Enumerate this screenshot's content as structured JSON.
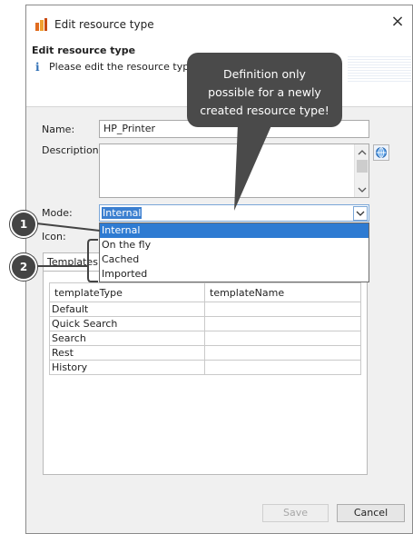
{
  "window": {
    "title": "Edit resource type",
    "close_symbol": "×",
    "icon": "app-icon"
  },
  "header": {
    "title": "Edit resource type",
    "info_symbol": "i",
    "message": "Please edit the resource type da"
  },
  "form": {
    "name_label": "Name:",
    "name_value": "HP_Printer",
    "description_label": "Description:",
    "description_value": "",
    "mode_label": "Mode:",
    "mode_value": "Internal",
    "icon_label": "Icon:"
  },
  "dropdown": {
    "options": [
      "Internal",
      "On the fly",
      "Cached",
      "Imported"
    ],
    "selected_index": 0
  },
  "tabs": {
    "active_label": "Templates"
  },
  "templates_table": {
    "columns": [
      "templateType",
      "templateName"
    ],
    "rows": [
      [
        "Default",
        ""
      ],
      [
        "Quick Search",
        ""
      ],
      [
        "Search",
        ""
      ],
      [
        "Rest",
        ""
      ],
      [
        "History",
        ""
      ]
    ]
  },
  "buttons": {
    "save_label": "Save",
    "cancel_label": "Cancel"
  },
  "annotations": {
    "callout_lines": [
      "Definition only",
      "possible for a newly",
      "created resource type!"
    ],
    "marker_1": "1",
    "marker_2": "2"
  },
  "colors": {
    "selection_blue": "#2e7bd2",
    "callout_bg": "#4a4a4a",
    "dialog_bg": "#f0f0f0"
  }
}
